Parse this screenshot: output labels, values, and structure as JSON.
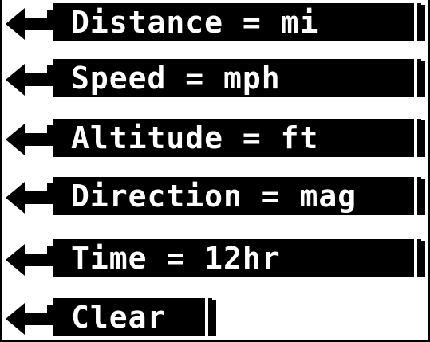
{
  "menu": {
    "items": [
      {
        "label": "Distance = mi"
      },
      {
        "label": "Speed = mph"
      },
      {
        "label": "Altitude = ft"
      },
      {
        "label": "Direction = mag"
      },
      {
        "label": "Time = 12hr"
      },
      {
        "label": "Clear"
      }
    ]
  },
  "icons": {
    "back_arrow": "return-arrow-icon"
  },
  "colors": {
    "background": "#ffffff",
    "highlight": "#000000",
    "text_inverse": "#ffffff"
  }
}
